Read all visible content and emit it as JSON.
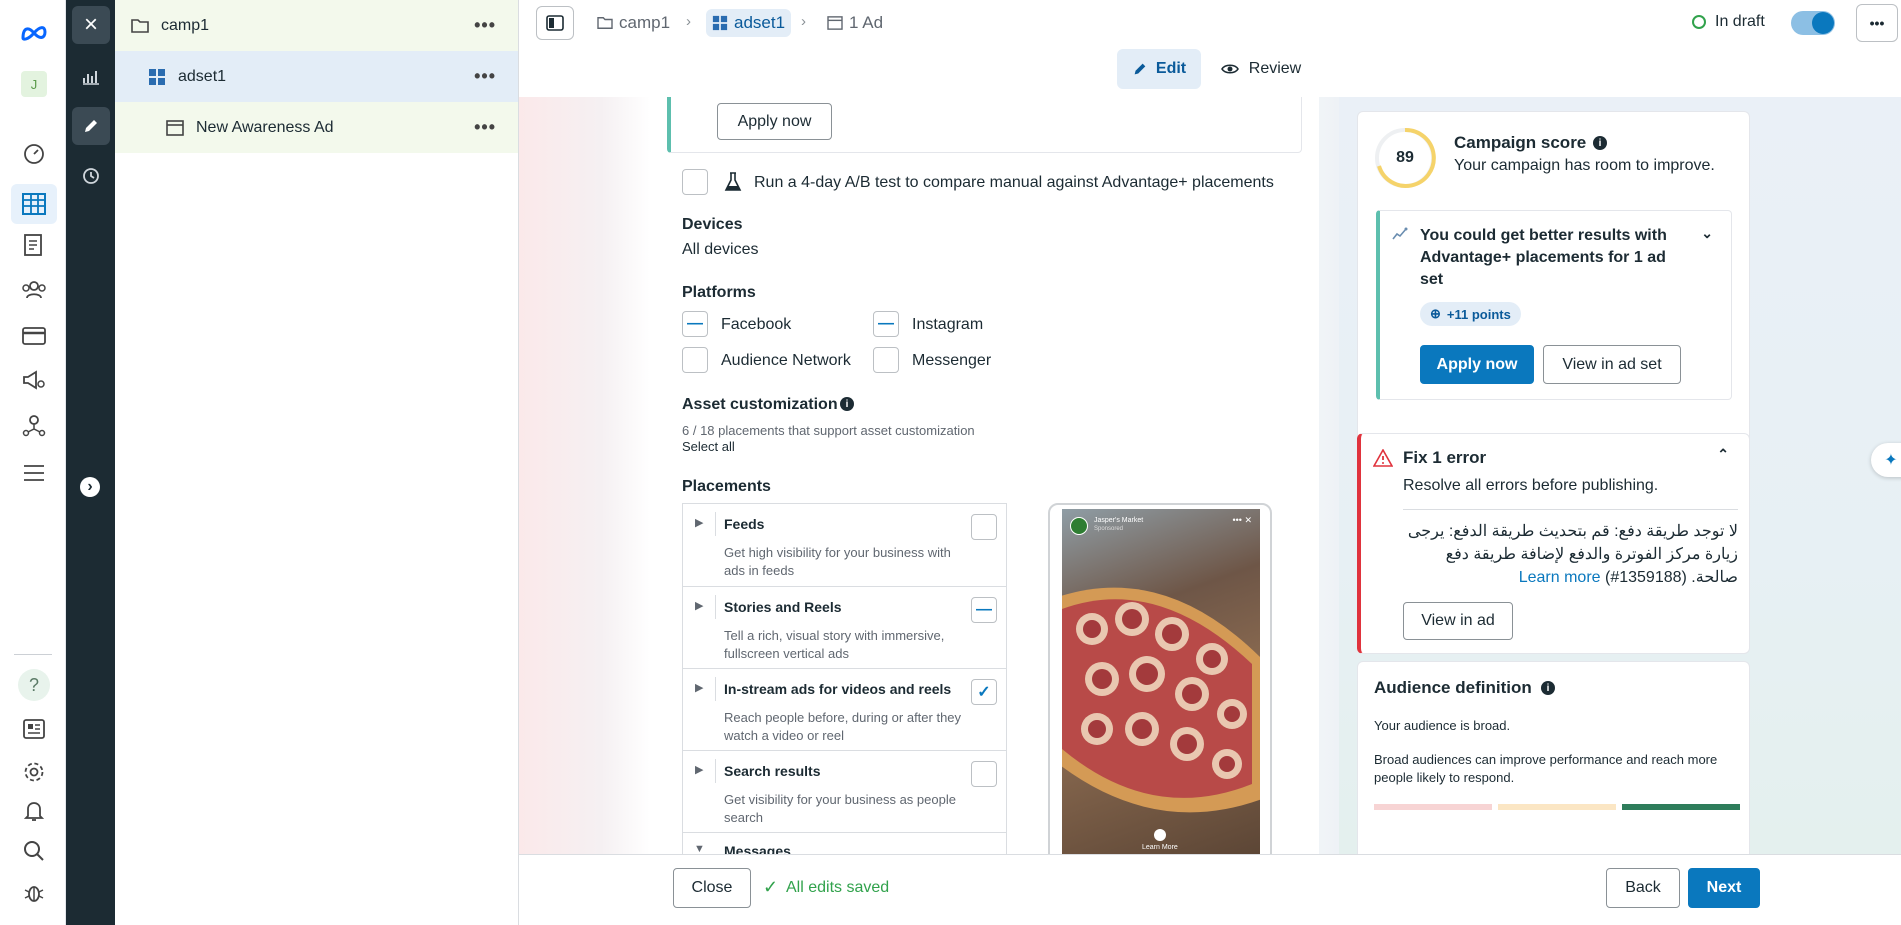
{
  "rail": {
    "logo": "meta-logo",
    "avatar_initial": "J",
    "icons": [
      "dashboard-icon",
      "table-icon",
      "pages-icon",
      "audience-icon",
      "billing-icon",
      "ads-icon",
      "network-icon",
      "menu-icon"
    ],
    "bottom_icons": [
      "help-icon",
      "news-icon",
      "settings-icon",
      "bell-icon",
      "search-icon",
      "bug-icon"
    ]
  },
  "strip": {
    "close": "×",
    "icons": [
      "chart-icon",
      "pencil-icon",
      "history-icon"
    ],
    "expand": "›"
  },
  "tree": {
    "items": [
      {
        "label": "camp1",
        "icon": "folder-icon"
      },
      {
        "label": "adset1",
        "icon": "grid-icon"
      },
      {
        "label": "New Awareness Ad",
        "icon": "ad-icon"
      }
    ],
    "more": "•••"
  },
  "topbar": {
    "breadcrumb": [
      {
        "label": "camp1"
      },
      {
        "label": "adset1"
      },
      {
        "label": "1 Ad"
      }
    ],
    "status": "In draft",
    "more": "•••",
    "edit_label": "Edit",
    "review_label": "Review"
  },
  "form": {
    "apply_now": "Apply now",
    "ab_test": "Run a 4-day A/B test to compare manual against Advantage+ placements",
    "devices_title": "Devices",
    "devices_value": "All devices",
    "platforms_title": "Platforms",
    "platforms": [
      {
        "label": "Facebook",
        "state": "partial"
      },
      {
        "label": "Instagram",
        "state": "partial"
      },
      {
        "label": "Audience Network",
        "state": "off"
      },
      {
        "label": "Messenger",
        "state": "off"
      }
    ],
    "asset_title": "Asset customization",
    "asset_desc": "6 / 18 placements that support asset customization",
    "select_all": "Select all",
    "placements_title": "Placements",
    "placements": [
      {
        "title": "Feeds",
        "desc": "Get high visibility for your business with ads in feeds",
        "state": "off"
      },
      {
        "title": "Stories and Reels",
        "desc": "Tell a rich, visual story with immersive, fullscreen vertical ads",
        "state": "partial"
      },
      {
        "title": "In-stream ads for videos and reels",
        "desc": "Reach people before, during or after they watch a video or reel",
        "state": "on"
      },
      {
        "title": "Search results",
        "desc": "Get visibility for your business as people search",
        "state": "off"
      },
      {
        "title": "Messages",
        "desc": "",
        "state": "off"
      }
    ],
    "preview": {
      "brand": "Jasper's Market",
      "sponsored": "Sponsored",
      "cta": "Learn More"
    }
  },
  "right": {
    "score_value": "89",
    "score_title": "Campaign score",
    "score_desc": "Your campaign has room to improve.",
    "rec_title": "You could get better results with Advantage+ placements for 1 ad set",
    "rec_points": "+11 points",
    "rec_apply": "Apply now",
    "rec_view": "View in ad set",
    "error_title": "Fix 1 error",
    "error_desc": "Resolve all errors before publishing.",
    "error_msg": "لا توجد طريقة دفع: قم بتحديث طريقة الدفع: يرجى زيارة مركز الفوترة والدفع لإضافة طريقة دفع صالحة. (1359188#)",
    "error_learn": "Learn more",
    "error_view": "View in ad",
    "aud_title": "Audience definition",
    "aud_desc1": "Your audience is broad.",
    "aud_desc2": "Broad audiences can improve performance and reach more people likely to respond."
  },
  "bottom": {
    "close": "Close",
    "saved": "All edits saved",
    "back": "Back",
    "next": "Next"
  },
  "colors": {
    "accent": "#0a78be",
    "error": "#e0333d",
    "success": "#31a24c",
    "dark": "#1c2b33"
  }
}
